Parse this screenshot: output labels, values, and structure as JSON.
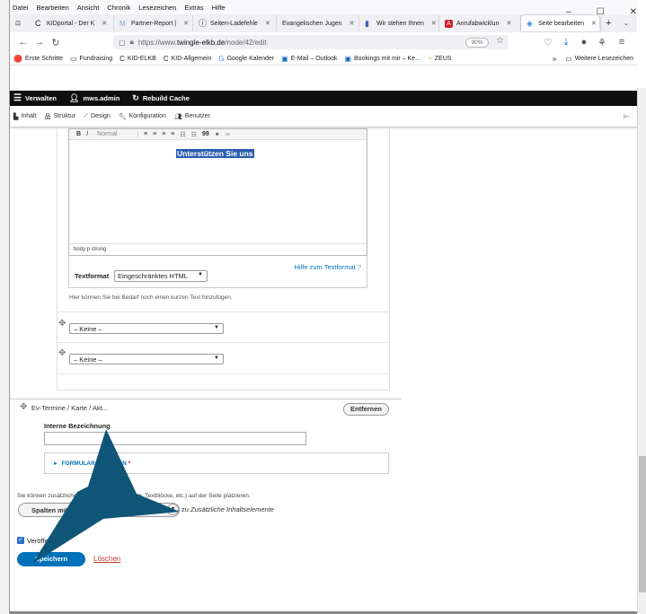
{
  "browser": {
    "menu": [
      "Datei",
      "Bearbeiten",
      "Ansicht",
      "Chronik",
      "Lesezeichen",
      "Extras",
      "Hilfe"
    ],
    "tabs": [
      {
        "label": "KIDportal - Der K",
        "color": "#ffffff",
        "icon": "C"
      },
      {
        "label": "Partner-Report |",
        "color": "#8aa2d6",
        "icon": "M"
      },
      {
        "label": "Seiten-Ladefehle",
        "color": "#ffffff",
        "icon": "ⓘ"
      },
      {
        "label": "Evangelischen Jugen",
        "color": "#ffffff",
        "icon": ""
      },
      {
        "label": "Wir stehen Ihnen",
        "color": "#3b66c4",
        "icon": "▮"
      },
      {
        "label": "Anrufabwicklun",
        "color": "#d1202a",
        "icon": "A"
      },
      {
        "label": "Seite bearbeiten",
        "color": "#1e88e5",
        "icon": "◈",
        "active": true
      }
    ],
    "url_prefix": "https://www.",
    "url_domain": "twingle-elkb.de",
    "url_path": "/node/42/edit",
    "zoom": "90%",
    "bookmarks": [
      {
        "label": "Erste Schritte",
        "icon": "🔴"
      },
      {
        "label": "Fundraising",
        "icon": "▭"
      },
      {
        "label": "KID-ELKB",
        "icon": "C"
      },
      {
        "label": "KID-Allgemein",
        "icon": "C"
      },
      {
        "label": "Google Kalender",
        "icon": "G"
      },
      {
        "label": "E-Mail – Outlook",
        "icon": "▣"
      },
      {
        "label": "Bookings mit mir – Ke...",
        "icon": "▣"
      },
      {
        "label": "ZEUS",
        "icon": "◔"
      }
    ],
    "bookmarks_more": "Weitere Lesezeichen"
  },
  "drupal": {
    "toolbar": [
      "Verwalten",
      "mws.admin",
      "Rebuild Cache"
    ],
    "tray": [
      "Inhalt",
      "Struktur",
      "Design",
      "Konfiguration",
      "Benutzer"
    ]
  },
  "editor": {
    "style_select": "Normal",
    "selected_text": "Unterstützen Sie uns",
    "status_path": "body  p  strong",
    "textformat_label": "Textformat",
    "textformat_value": "Eingeschränktes HTML",
    "help_link": "Hilfe zum Textformat",
    "hint": "Hier können Sie bei Bedarf noch einen kurzen Text hinzufügen."
  },
  "selects": [
    {
      "value": "– Keine –"
    },
    {
      "value": "– Keine –"
    }
  ],
  "paragraph": {
    "title": "Ev-Termine / Karte / Akt...",
    "remove_button": "Entfernen",
    "field_label": "Interne Bezeichnung",
    "details_label": "FORMULAR ANZEIGEN",
    "required_mark": "*"
  },
  "add_content": {
    "info": "Sie können zusätzliche Inhaltselemente (Banner, Textblöcke, etc.) auf der Seite platzieren.",
    "button": "Spalten mit Text",
    "suffix_prefix": "zu ",
    "suffix_em": "Zusätzliche Inhaltselemente"
  },
  "actions": {
    "publish_label": "Veröffentlicht",
    "save_button": "Speichern",
    "delete_link": "Löschen"
  },
  "colors": {
    "accent": "#0071b8",
    "highlight": "#2a5db0",
    "arrow": "#0f5577"
  }
}
